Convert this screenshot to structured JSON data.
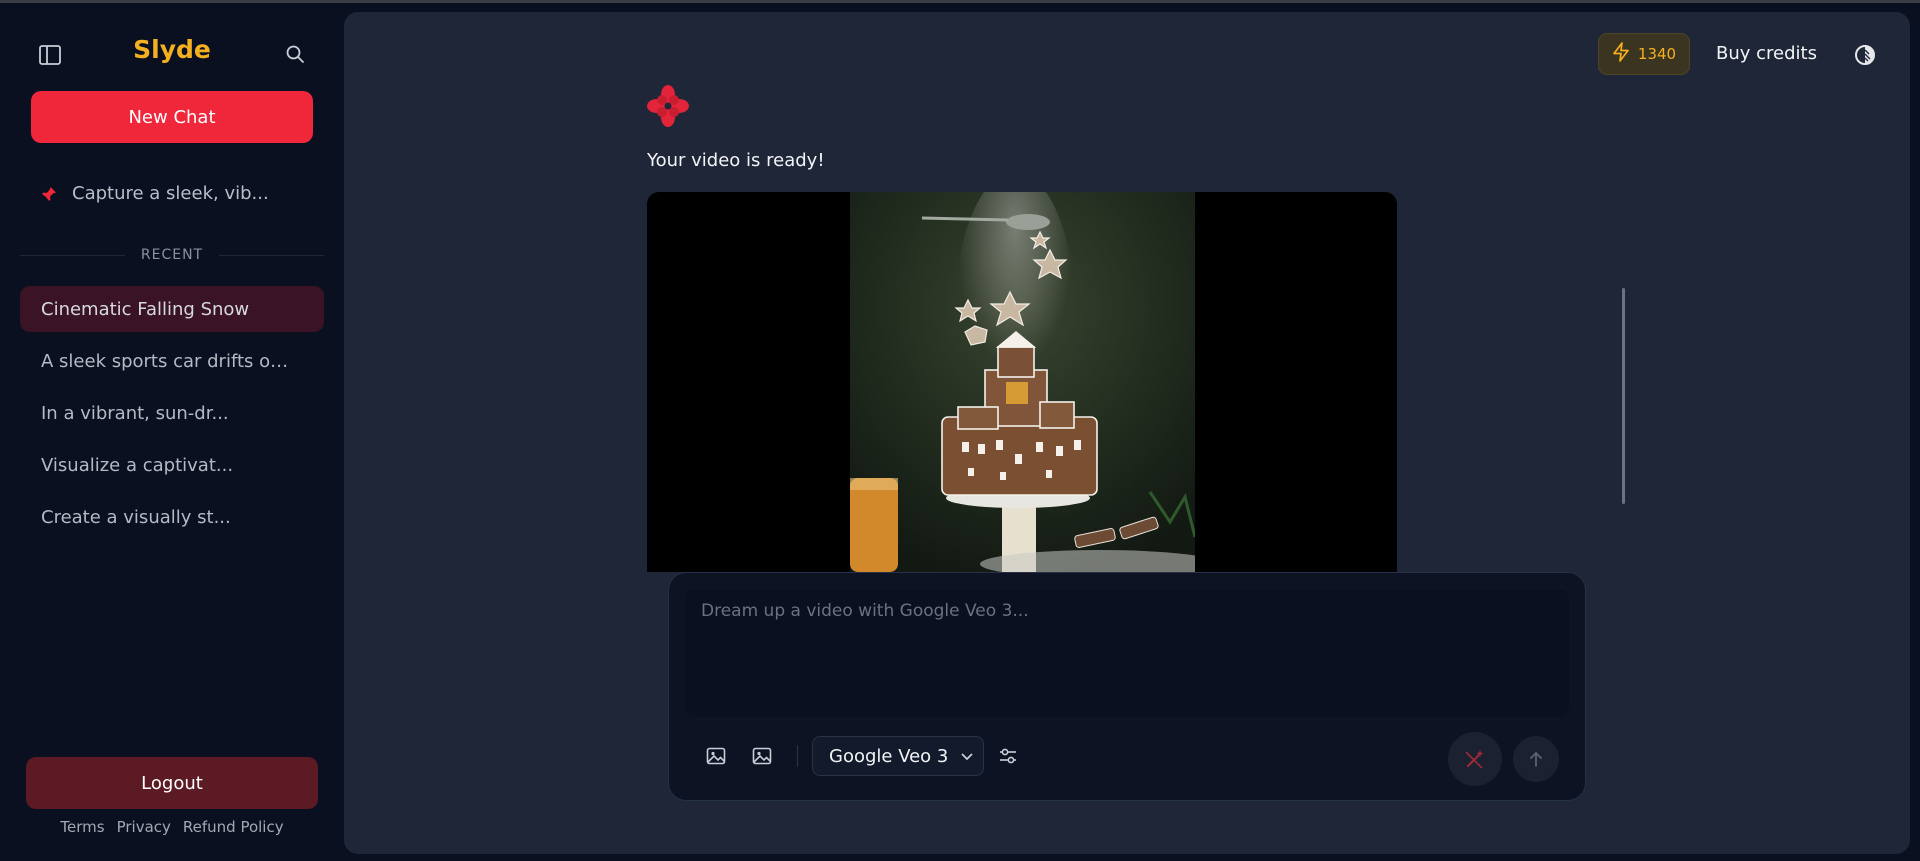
{
  "sidebar": {
    "brand": "Slyde",
    "new_chat_label": "New Chat",
    "pinned_chat": "Capture a sleek, vib...",
    "recent_heading": "RECENT",
    "recent_chats": [
      "Cinematic Falling Snow",
      "A sleek sports car drifts o…",
      "In a vibrant, sun-dr...",
      "Visualize a captivat...",
      "Create a visually st..."
    ],
    "active_index": 0,
    "logout_label": "Logout",
    "legal_links": [
      "Terms",
      "Privacy",
      "Refund Policy"
    ]
  },
  "header": {
    "credits": "1340",
    "buy_credits_label": "Buy credits"
  },
  "conversation": {
    "message": "Your video is ready!"
  },
  "composer": {
    "placeholder": "Dream up a video with Google Veo 3...",
    "value": "",
    "model": "Google Veo 3"
  },
  "icons": {
    "sidebar_toggle": "sidebar-toggle-icon",
    "search": "search-icon",
    "pin": "pin-icon",
    "credits": "lightning-icon",
    "theme": "contrast-icon",
    "upload_start_image": "image-icon",
    "upload_end_image": "image-icon",
    "settings": "sliders-icon",
    "enhance": "magic-wand-icon",
    "send": "arrow-up-icon"
  },
  "colors": {
    "brand": "#f5b020",
    "accent": "#f0263a",
    "logout": "#5c1a24",
    "active_chat": "#3a1425"
  }
}
